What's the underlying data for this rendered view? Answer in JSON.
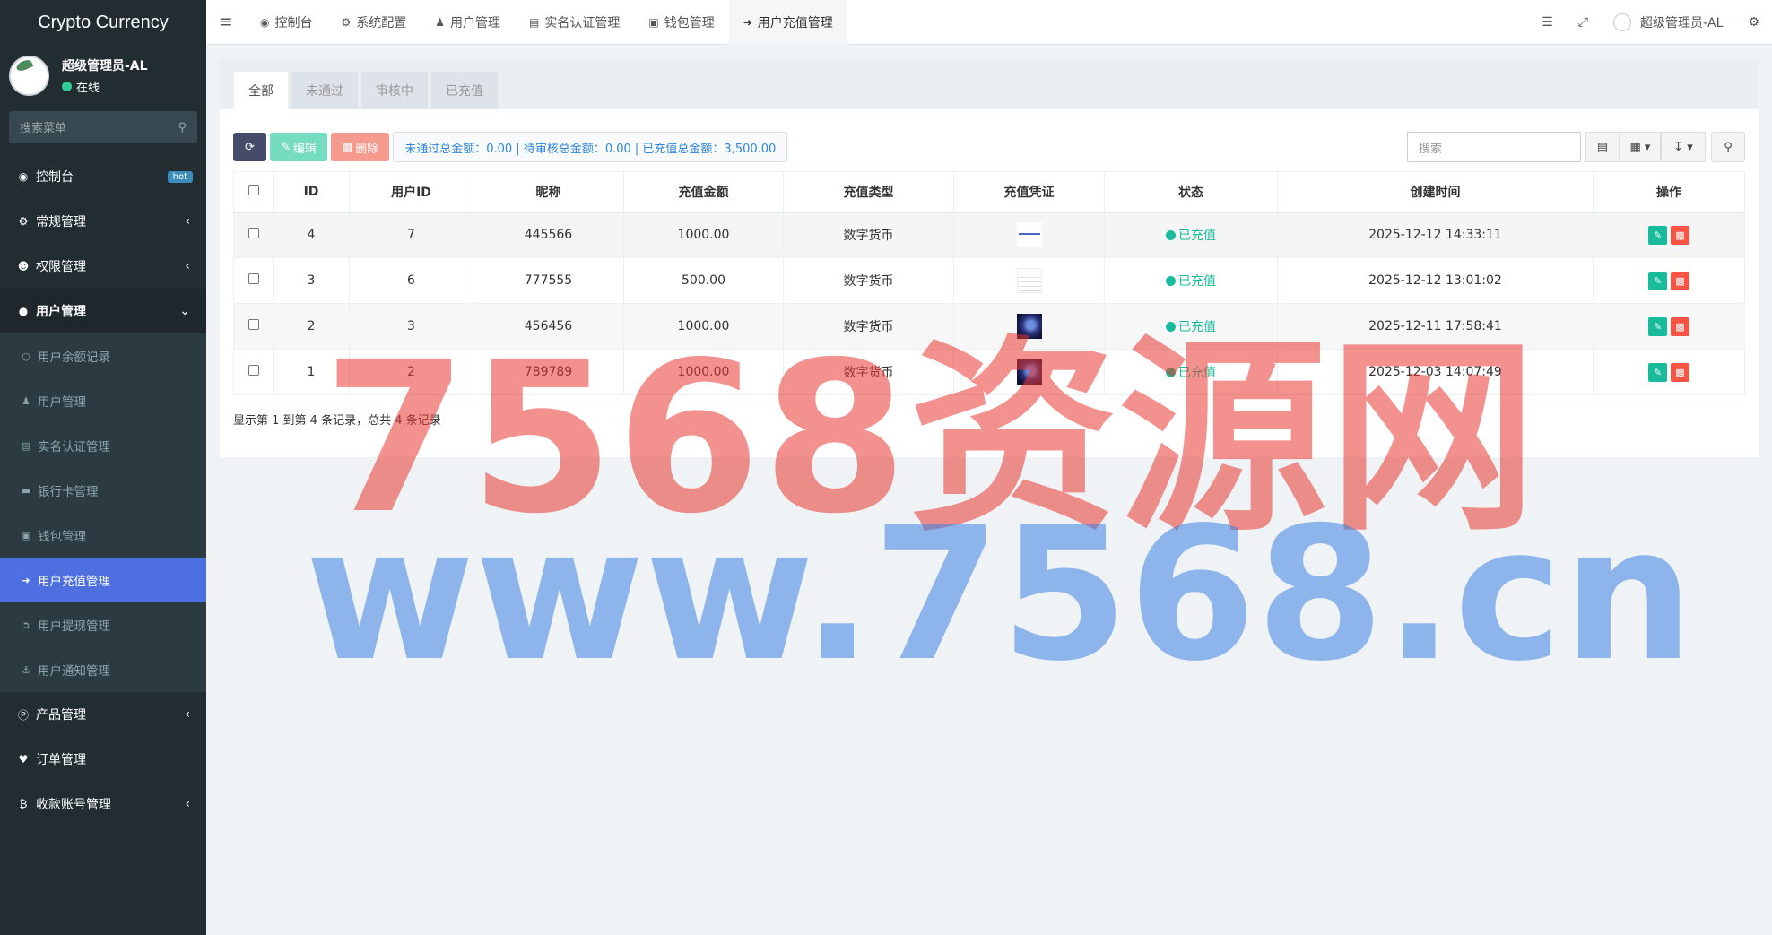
{
  "app": {
    "title": "Crypto Currency"
  },
  "user": {
    "name": "超级管理员-AL",
    "status": "在线"
  },
  "sidebar": {
    "search_placeholder": "搜索菜单",
    "items": [
      {
        "label": "控制台",
        "badge": "hot"
      },
      {
        "label": "常规管理"
      },
      {
        "label": "权限管理"
      },
      {
        "label": "用户管理"
      },
      {
        "label": "产品管理"
      },
      {
        "label": "订单管理"
      },
      {
        "label": "收款账号管理"
      }
    ],
    "sub_items": [
      {
        "label": "用户余额记录"
      },
      {
        "label": "用户管理"
      },
      {
        "label": "实名认证管理"
      },
      {
        "label": "银行卡管理"
      },
      {
        "label": "钱包管理"
      },
      {
        "label": "用户充值管理"
      },
      {
        "label": "用户提现管理"
      },
      {
        "label": "用户通知管理"
      }
    ]
  },
  "topbar": {
    "tabs": [
      {
        "label": "控制台"
      },
      {
        "label": "系统配置"
      },
      {
        "label": "用户管理"
      },
      {
        "label": "实名认证管理"
      },
      {
        "label": "钱包管理"
      },
      {
        "label": "用户充值管理"
      }
    ],
    "user_name": "超级管理员-AL"
  },
  "content": {
    "tabs": [
      {
        "label": "全部"
      },
      {
        "label": "未通过"
      },
      {
        "label": "审核中"
      },
      {
        "label": "已充值"
      }
    ],
    "edit_label": "编辑",
    "delete_label": "删除",
    "summary": "未通过总金额：0.00 | 待审核总金额：0.00 | 已充值总金额：3,500.00",
    "search_placeholder": "搜索",
    "columns": [
      "ID",
      "用户ID",
      "昵称",
      "充值金额",
      "充值类型",
      "充值凭证",
      "状态",
      "创建时间",
      "操作"
    ],
    "rows": [
      {
        "id": "4",
        "uid": "7",
        "nick": "445566",
        "amount": "1000.00",
        "type": "数字货币",
        "status": "已充值",
        "time": "2025-12-12 14:33:11"
      },
      {
        "id": "3",
        "uid": "6",
        "nick": "777555",
        "amount": "500.00",
        "type": "数字货币",
        "status": "已充值",
        "time": "2025-12-12 13:01:02"
      },
      {
        "id": "2",
        "uid": "3",
        "nick": "456456",
        "amount": "1000.00",
        "type": "数字货币",
        "status": "已充值",
        "time": "2025-12-11 17:58:41"
      },
      {
        "id": "1",
        "uid": "2",
        "nick": "789789",
        "amount": "1000.00",
        "type": "数字货币",
        "status": "已充值",
        "time": "2025-12-03 14:07:49"
      }
    ],
    "pager": "显示第 1 到第 4 条记录，总共 4 条记录"
  },
  "watermark": {
    "line1": "7568资源网",
    "line2": "www.7568.cn"
  },
  "colors": {
    "sidebar_bg": "#222d32",
    "active": "#4d6fe0",
    "success": "#18bc9c",
    "danger": "#f75444"
  }
}
